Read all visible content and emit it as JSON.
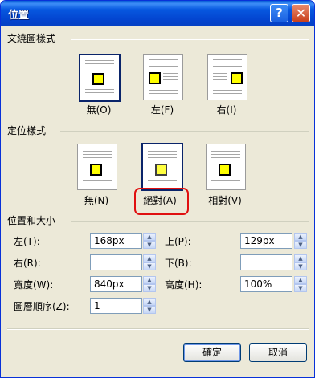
{
  "window": {
    "title": "位置"
  },
  "title_buttons": {
    "help": "?",
    "close": "✕"
  },
  "wrap_section": {
    "title": "文繞圖樣式",
    "options": [
      {
        "label": "無(O)",
        "selected": true
      },
      {
        "label": "左(F)",
        "selected": false
      },
      {
        "label": "右(I)",
        "selected": false
      }
    ]
  },
  "position_section": {
    "title": "定位樣式",
    "options": [
      {
        "label": "無(N)",
        "selected": false
      },
      {
        "label": "絕對(A)",
        "selected": true
      },
      {
        "label": "相對(V)",
        "selected": false
      }
    ]
  },
  "size_section": {
    "title": "位置和大小",
    "left": {
      "label": "左(T):",
      "value": "168px"
    },
    "top": {
      "label": "上(P):",
      "value": "129px"
    },
    "right": {
      "label": "右(R):",
      "value": ""
    },
    "bottom": {
      "label": "下(B):",
      "value": ""
    },
    "width": {
      "label": "寬度(W):",
      "value": "840px"
    },
    "height": {
      "label": "高度(H):",
      "value": "100%"
    },
    "zorder": {
      "label": "圖層順序(Z):",
      "value": "1"
    }
  },
  "buttons": {
    "ok": "確定",
    "cancel": "取消"
  },
  "colors": {
    "title_bar": "#0758e0",
    "dialog_bg": "#ece9d8",
    "highlight": "#e01010",
    "marker": "#ffff00"
  }
}
